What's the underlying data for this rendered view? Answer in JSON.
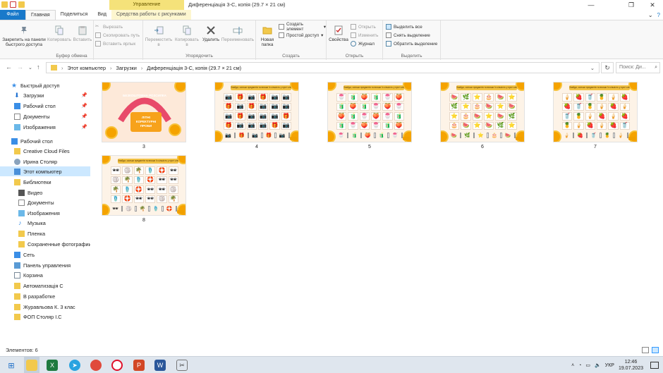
{
  "window": {
    "context_tab_label": "Управление",
    "title": "Диференціація 3-С, копія (29.7 × 21 см)",
    "minimize": "—",
    "maximize": "❐",
    "close": "✕"
  },
  "tabs": [
    {
      "label": "Файл"
    },
    {
      "label": "Главная"
    },
    {
      "label": "Поделиться"
    },
    {
      "label": "Вид"
    },
    {
      "label": "Средства работы с рисунками"
    }
  ],
  "ribbon": {
    "clipboard": {
      "group_label": "Буфер обмена",
      "pin_label_1": "Закрепить на панели",
      "pin_label_2": "быстрого доступа",
      "copy": "Копировать",
      "paste": "Вставить",
      "cut": "Вырезать",
      "copy_path": "Скопировать путь",
      "paste_shortcut": "Вставить ярлык"
    },
    "organize": {
      "group_label": "Упорядочить",
      "move_to_1": "Переместить",
      "move_to_2": "в",
      "copy_to_1": "Копировать",
      "copy_to_2": "в",
      "delete": "Удалить",
      "rename": "Переименовать"
    },
    "new": {
      "group_label": "Создать",
      "new_folder_1": "Новая",
      "new_folder_2": "папка",
      "new_item": "Создать элемент",
      "easy_access": "Простой доступ"
    },
    "open": {
      "group_label": "Открыть",
      "properties": "Свойства",
      "open": "Открыть",
      "edit": "Изменить",
      "history": "Журнал"
    },
    "select": {
      "group_label": "Выделить",
      "select_all": "Выделить все",
      "select_none": "Снять выделение",
      "invert": "Обратить выделение"
    }
  },
  "address": {
    "segments": [
      "Этот компьютер",
      "Загрузки",
      "Диференціація 3-С, копія (29.7 × 21 см)"
    ],
    "search_placeholder": "Поиск: Ди..."
  },
  "nav": [
    {
      "label": "Быстрый доступ",
      "pinned": false
    },
    {
      "label": "Загрузки",
      "pinned": true
    },
    {
      "label": "Рабочий стол",
      "pinned": true
    },
    {
      "label": "Документы",
      "pinned": true
    },
    {
      "label": "Изображения",
      "pinned": true
    },
    {
      "label": "Рабочий стол",
      "pinned": false
    },
    {
      "label": "Creative Cloud Files",
      "pinned": false
    },
    {
      "label": "Ирина Столяр",
      "pinned": false
    },
    {
      "label": "Этот компьютер",
      "pinned": false
    },
    {
      "label": "Библиотеки",
      "pinned": false
    },
    {
      "label": "Видео",
      "pinned": false
    },
    {
      "label": "Документы",
      "pinned": false
    },
    {
      "label": "Изображения",
      "pinned": false
    },
    {
      "label": "Музыка",
      "pinned": false
    },
    {
      "label": "Пленка",
      "pinned": false
    },
    {
      "label": "Сохраненные фотографии",
      "pinned": false
    },
    {
      "label": "Сеть",
      "pinned": false
    },
    {
      "label": "Панель управления",
      "pinned": false
    },
    {
      "label": "Корзина",
      "pinned": false
    },
    {
      "label": "Автоматизація С",
      "pinned": false
    },
    {
      "label": "В разработке",
      "pinned": false
    },
    {
      "label": "Журавльова К. 3 клас",
      "pinned": false
    },
    {
      "label": "ФОП Столяр І.С",
      "pinned": false
    }
  ],
  "files": [
    {
      "name": "3",
      "kind": "title",
      "title_lines": [
        "БЕЗКОШТОВНА РОЗСИЛКА"
      ],
      "box_lines": [
        "ЛІТНІ",
        "КОРЕКТУРНІ",
        "ПРОБИ"
      ]
    },
    {
      "name": "4",
      "kind": "grid",
      "icons": [
        "📷",
        "🎁",
        "📷",
        "🎁",
        "📷",
        "📷"
      ]
    },
    {
      "name": "5",
      "kind": "grid",
      "icons": [
        "🍧",
        "🧃",
        "🍑",
        "🧃",
        "🍧",
        "🍑"
      ]
    },
    {
      "name": "6",
      "kind": "grid",
      "icons": [
        "🍉",
        "🌿",
        "⭐",
        "🎂",
        "🍉",
        "⭐"
      ]
    },
    {
      "name": "7",
      "kind": "grid",
      "icons": [
        "🍦",
        "🍓",
        "🥤",
        "🍍",
        "🍦",
        "🍓"
      ]
    },
    {
      "name": "8",
      "kind": "grid",
      "icons": [
        "🕶",
        "🏐",
        "🌴",
        "🩴",
        "🛟",
        "🕶"
      ]
    }
  ],
  "slide_banner": "Знайди, скільки предметів та впиши їх кількість у пусті клітинки",
  "status": {
    "item_count": "Элементов: 6"
  },
  "taskbar": {
    "lang": "УКР",
    "time": "12:46",
    "date": "19.07.2023"
  }
}
